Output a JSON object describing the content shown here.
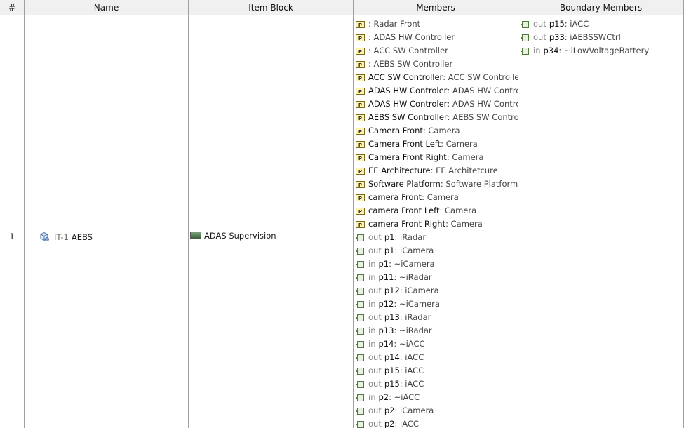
{
  "headers": {
    "num": "#",
    "name": "Name",
    "item_block": "Item Block",
    "members": "Members",
    "boundary": "Boundary Members"
  },
  "row": {
    "number": "1",
    "name_id": "IT-1",
    "name": "AEBS",
    "item_block": "ADAS Supervision"
  },
  "members": [
    {
      "name": "",
      "type": ": Radar Front"
    },
    {
      "name": "",
      "type": ": ADAS HW Controller"
    },
    {
      "name": "",
      "type": ": ACC SW Controller"
    },
    {
      "name": "",
      "type": ": AEBS SW Controller"
    },
    {
      "name": "ACC SW Controller",
      "type": ": ACC SW Controller"
    },
    {
      "name": "ADAS HW Controler",
      "type": ": ADAS HW Controller"
    },
    {
      "name": "ADAS HW Controler",
      "type": ": ADAS HW Controller"
    },
    {
      "name": "AEBS SW Controller",
      "type": ": AEBS SW Controller"
    },
    {
      "name": "Camera Front",
      "type": ": Camera"
    },
    {
      "name": "Camera Front Left",
      "type": ": Camera"
    },
    {
      "name": "Camera Front Right",
      "type": ": Camera"
    },
    {
      "name": "EE Architecture",
      "type": ": EE Architetcure"
    },
    {
      "name": "Software Platform",
      "type": ": Software Platform"
    },
    {
      "name": "camera Front",
      "type": ": Camera"
    },
    {
      "name": "camera Front Left",
      "type": ": Camera"
    },
    {
      "name": "camera Front Right",
      "type": ": Camera"
    }
  ],
  "member_ports": [
    {
      "dir": "out",
      "name": "p1",
      "type": ": iRadar"
    },
    {
      "dir": "out",
      "name": "p1",
      "type": ": iCamera"
    },
    {
      "dir": "in",
      "name": "p1",
      "type": ": ~iCamera"
    },
    {
      "dir": "in",
      "name": "p11",
      "type": ": ~iRadar"
    },
    {
      "dir": "out",
      "name": "p12",
      "type": ": iCamera"
    },
    {
      "dir": "in",
      "name": "p12",
      "type": ": ~iCamera"
    },
    {
      "dir": "out",
      "name": "p13",
      "type": ": iRadar"
    },
    {
      "dir": "in",
      "name": "p13",
      "type": ": ~iRadar"
    },
    {
      "dir": "in",
      "name": "p14",
      "type": ": ~iACC"
    },
    {
      "dir": "out",
      "name": "p14",
      "type": ": iACC"
    },
    {
      "dir": "out",
      "name": "p15",
      "type": ": iACC"
    },
    {
      "dir": "out",
      "name": "p15",
      "type": ": iACC"
    },
    {
      "dir": "in",
      "name": "p2",
      "type": ": ~iACC"
    },
    {
      "dir": "out",
      "name": "p2",
      "type": ": iCamera"
    },
    {
      "dir": "out",
      "name": "p2",
      "type": ": iACC"
    }
  ],
  "boundary": [
    {
      "dir": "out",
      "name": "p15",
      "type": ": iACC"
    },
    {
      "dir": "out",
      "name": "p33",
      "type": ": iAEBSSWCtrl"
    },
    {
      "dir": "in",
      "name": "p34",
      "type": ": ~iLowVoltageBattery"
    }
  ]
}
